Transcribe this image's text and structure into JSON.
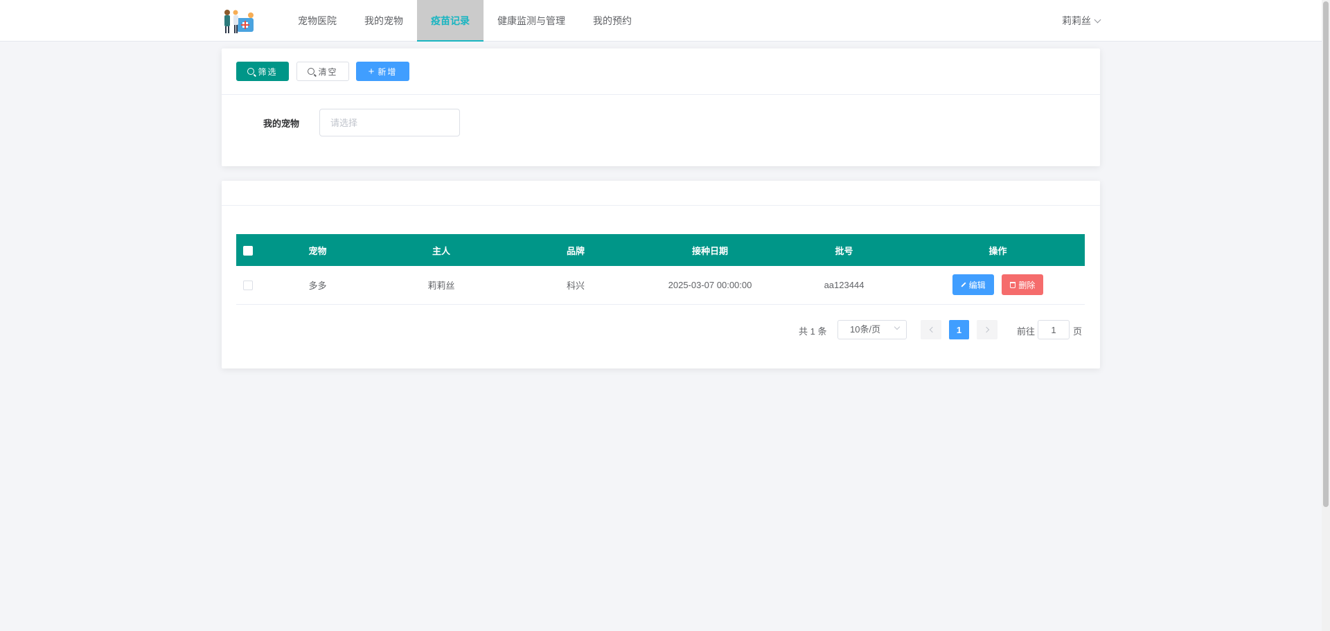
{
  "nav": {
    "logo_icon": "pet-doctor-logo",
    "items": [
      {
        "label": "宠物医院"
      },
      {
        "label": "我的宠物"
      },
      {
        "label": "疫苗记录",
        "active": true
      },
      {
        "label": "健康监测与管理"
      },
      {
        "label": "我的预约"
      }
    ],
    "user_name": "莉莉丝"
  },
  "toolbar": {
    "filter_label": "筛选",
    "clear_label": "清空",
    "add_label": "新增"
  },
  "filter_form": {
    "pet_label": "我的宠物",
    "pet_placeholder": "请选择"
  },
  "table": {
    "columns": [
      "宠物",
      "主人",
      "品牌",
      "接种日期",
      "批号",
      "操作"
    ],
    "rows": [
      {
        "pet": "多多",
        "owner": "莉莉丝",
        "brand": "科兴",
        "date": "2025-03-07 00:00:00",
        "batch": "aa123444",
        "edit_label": "编辑",
        "delete_label": "删除"
      }
    ]
  },
  "pagination": {
    "total_text": "共 1 条",
    "page_size": "10条/页",
    "current_page": "1",
    "goto_label": "前往",
    "goto_value": "1",
    "page_unit": "页"
  },
  "colors": {
    "primary_green": "#009688",
    "accent_blue": "#409eff",
    "danger_red": "#f56c6c",
    "nav_active_text": "#19b5c1"
  }
}
